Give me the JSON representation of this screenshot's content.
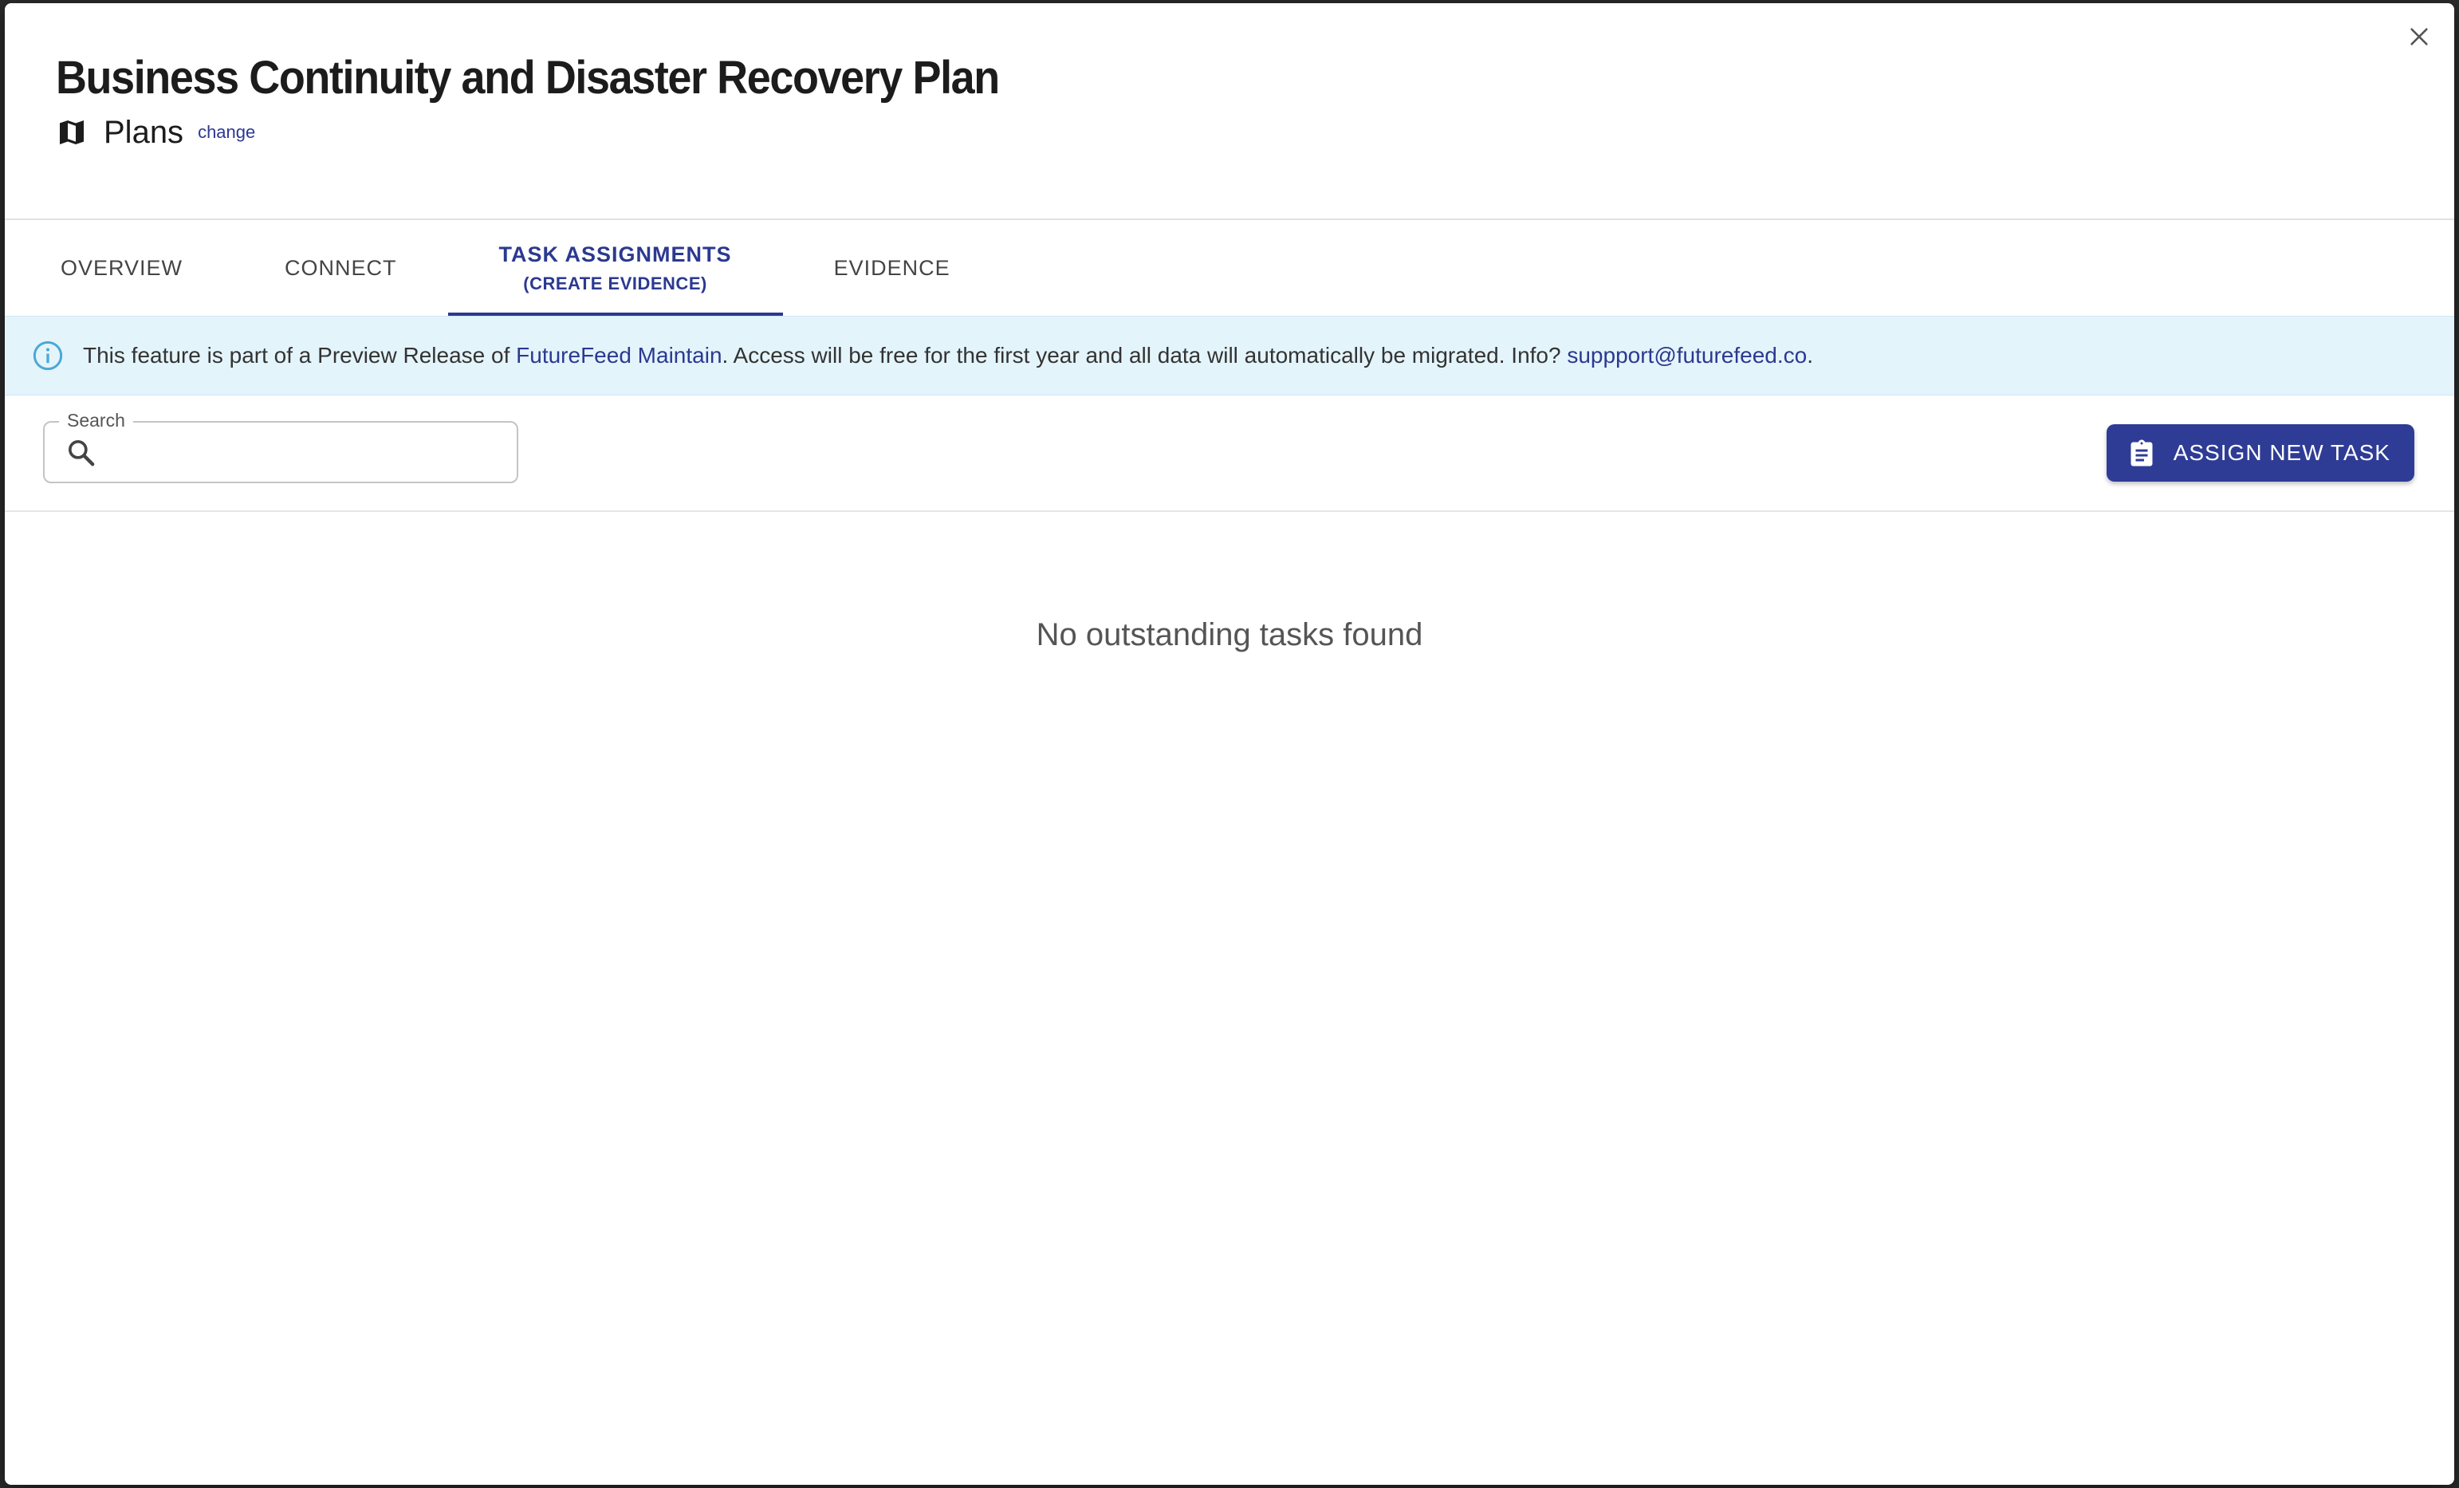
{
  "dialog": {
    "title": "Business Continuity and Disaster Recovery Plan",
    "category_label": "Plans",
    "change_link": "change"
  },
  "tabs": [
    {
      "label": "OVERVIEW",
      "active": false
    },
    {
      "label": "CONNECT",
      "active": false
    },
    {
      "label": "TASK ASSIGNMENTS",
      "sublabel": "(CREATE EVIDENCE)",
      "active": true
    },
    {
      "label": "EVIDENCE",
      "active": false
    }
  ],
  "banner": {
    "text_1": "This feature is part of a Preview Release of ",
    "product_link": "FutureFeed Maintain",
    "text_2": ". Access will be free for the first year and all data will automatically be migrated. Info? ",
    "email_link": "suppport@futurefeed.co",
    "text_3": "."
  },
  "search": {
    "label": "Search",
    "value": "",
    "placeholder": ""
  },
  "toolbar": {
    "assign_button": "ASSIGN NEW TASK"
  },
  "main": {
    "empty_message": "No outstanding tasks found"
  },
  "colors": {
    "accent": "#2b3990",
    "button_bg": "#2f3c96",
    "banner_bg": "#e4f4fb",
    "info_icon": "#4aa8d8"
  },
  "icons": {
    "close": "close-icon",
    "plans": "map-icon",
    "info": "info-icon",
    "search": "search-icon",
    "assign": "clipboard-icon"
  }
}
